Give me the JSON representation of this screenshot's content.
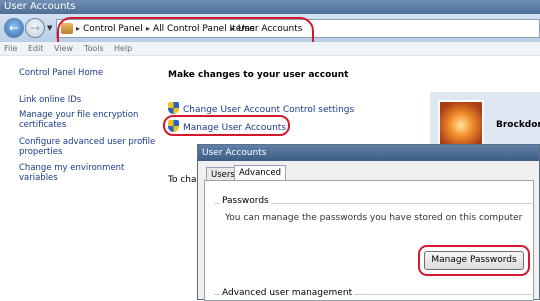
{
  "window": {
    "title": "User Accounts"
  },
  "addressbar": {
    "crumbs": [
      "Control Panel",
      "All Control Panel Items",
      "User Accounts"
    ]
  },
  "menu": [
    "File",
    "Edit",
    "View",
    "Tools",
    "Help"
  ],
  "leftpane": {
    "links": [
      "Control Panel Home",
      "Link online IDs",
      "Manage your file encryption certificates",
      "Configure advanced user profile properties",
      "Change my environment variables"
    ]
  },
  "main": {
    "heading": "Make changes to your user account",
    "tasks": [
      "Change User Account Control settings",
      "Manage User Accounts"
    ],
    "partial_text": "To chan"
  },
  "user": {
    "name": "Brockdorf,"
  },
  "dialog": {
    "title": "User Accounts",
    "tabs": [
      "Users",
      "Advanced"
    ],
    "active_tab": "Advanced",
    "passwords_group": "Passwords",
    "passwords_text": "You can manage the passwords you have stored on this computer",
    "manage_passwords_button": "Manage Passwords",
    "advanced_group": "Advanced user management"
  },
  "colors": {
    "annotation": "#d4182d",
    "link": "#1a3a8c"
  }
}
